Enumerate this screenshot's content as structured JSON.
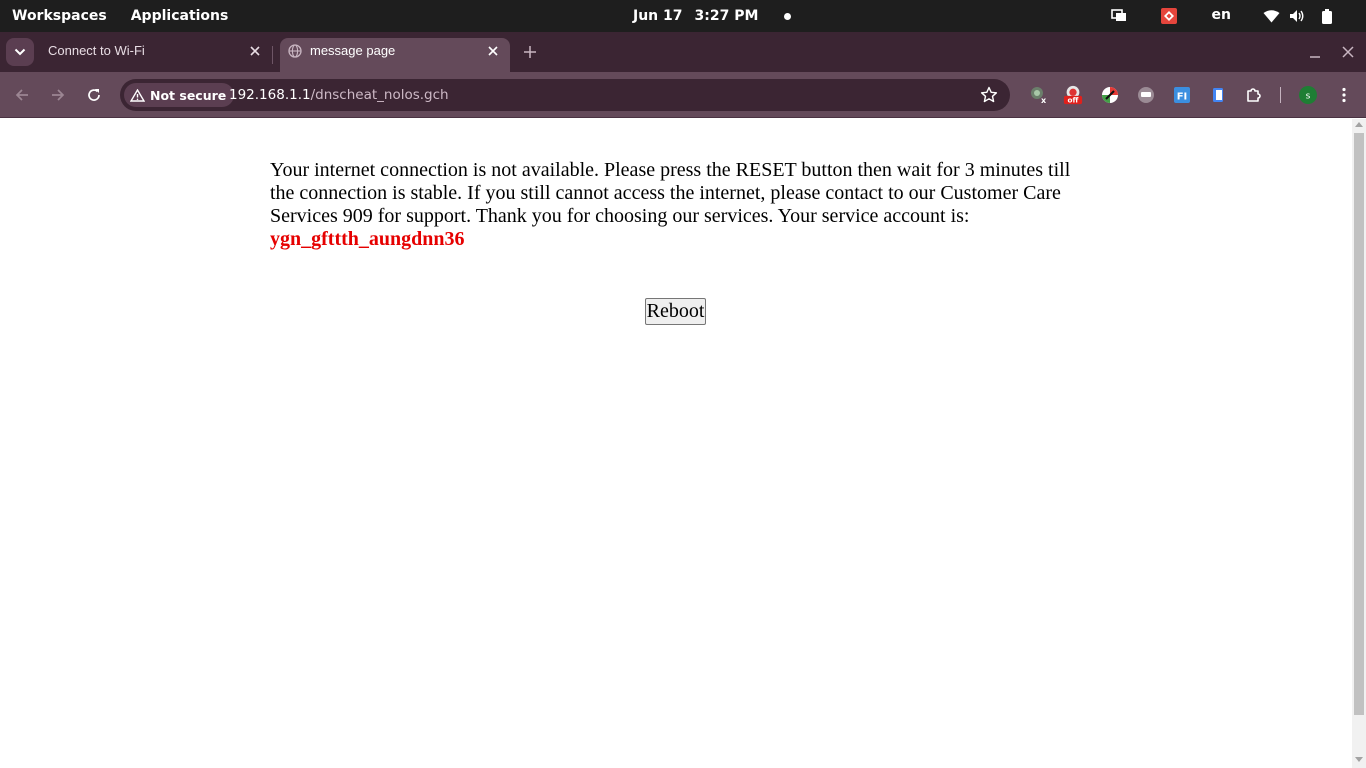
{
  "topbar": {
    "workspaces": "Workspaces",
    "applications": "Applications",
    "date": "Jun 17",
    "time": "3:27 PM",
    "lang": "en",
    "tray_icons": [
      "screen-share-icon",
      "anydesk-icon",
      "wifi-icon",
      "volume-icon",
      "battery-icon"
    ]
  },
  "tabs": [
    {
      "title": "Connect to Wi-Fi",
      "active": false
    },
    {
      "title": "message page",
      "active": true
    }
  ],
  "toolbar": {
    "security_label": "Not secure",
    "url_host": "192.168.1.1",
    "url_path": "/dnscheat_nolos.gch",
    "profile_initial": "s",
    "extension_badge": "off",
    "extension_icons": [
      "extension-x-icon",
      "extension-off-icon",
      "extension-color-icon",
      "extension-chat-icon",
      "extension-fi-icon",
      "extension-doc-icon",
      "extensions-puzzle-icon"
    ]
  },
  "page": {
    "message": "Your internet connection is not available. Please press the RESET button then wait for 3 minutes till the connection is stable. If you still cannot access the internet, please contact to our Customer Care Services 909 for support. Thank you for choosing our services. Your service account is:",
    "account": "ygn_gfttth_aungdnn36",
    "reboot_label": "Reboot"
  },
  "colors": {
    "topbar_bg": "#1e1e1e",
    "tabstrip_bg": "#3b2533",
    "toolbar_bg": "#644a5a",
    "account_text": "#e60000"
  }
}
